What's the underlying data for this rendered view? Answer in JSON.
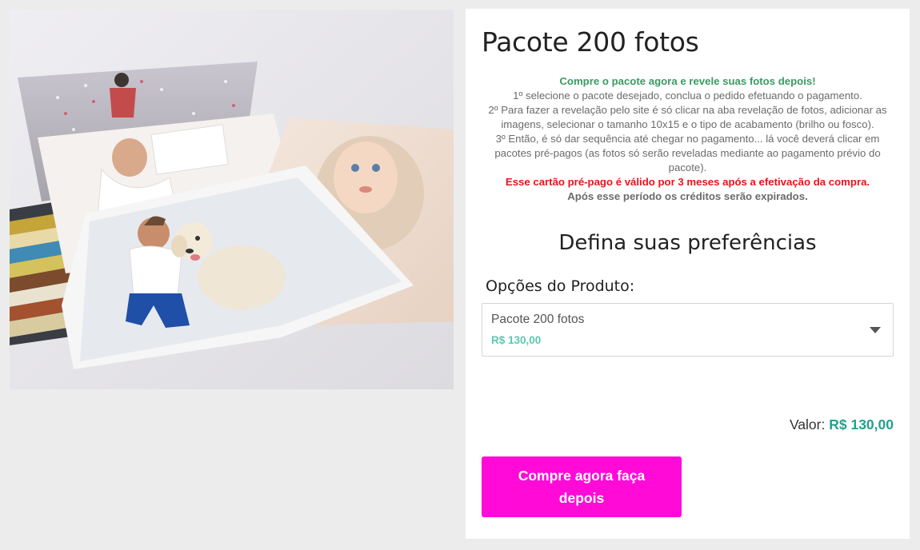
{
  "product": {
    "title": "Pacote 200 fotos",
    "image_alt": "product-photo-stack"
  },
  "description": {
    "headline": "Compre o pacote agora e revele suas fotos depois!",
    "step1": "1º selecione o pacote desejado, conclua o pedido efetuando o pagamento.",
    "step2": "2º Para fazer a revelação pelo site é só clicar na aba revelação de fotos, adicionar as imagens,  selecionar o tamanho 10x15 e o tipo de acabamento (brilho ou fosco).",
    "step3": "3º Então, é só dar sequência até chegar no pagamento... lá você deverá clicar em pacotes pré-pagos (as fotos só serão reveladas mediante ao pagamento prévio do pacote).",
    "warning": "Esse cartão pré-pago é válido por 3 meses após a efetivação da compra.",
    "expiry": "Após esse período os créditos serão expirados."
  },
  "preferences": {
    "title": "Defina suas preferências",
    "options_label": "Opções do Produto:",
    "select": {
      "selected_name": "Pacote 200 fotos",
      "selected_price": "R$ 130,00",
      "icon": "chevron-down-icon"
    }
  },
  "price": {
    "label": "Valor:",
    "amount": "R$ 130,00"
  },
  "actions": {
    "buy_label": "Compre agora faça depois"
  },
  "colors": {
    "accent_pink": "#ff0ad7",
    "price_teal": "#24a08b",
    "headline_green": "#3a9a62",
    "warning_red": "#e8141b"
  }
}
